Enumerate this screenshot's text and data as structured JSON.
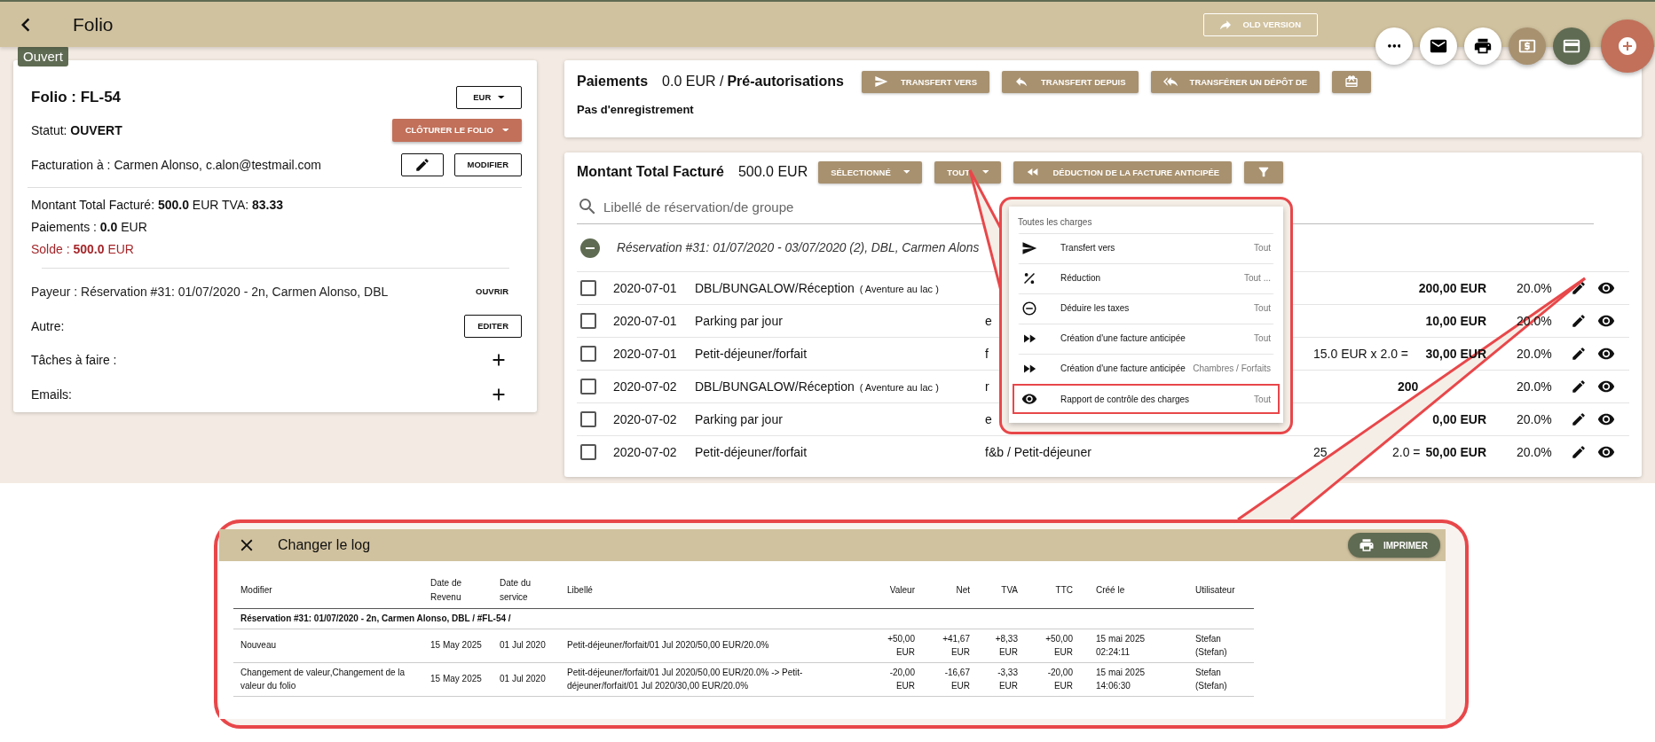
{
  "header": {
    "title": "Folio",
    "old_version_button": "OLD VERSION"
  },
  "folio_card": {
    "badge": "Ouvert",
    "title": "Folio : FL-54",
    "currency": "EUR",
    "status": "Statut: **OUVERT**",
    "close_button": "CLÔTURER LE FOLIO",
    "billing": "Facturation à : Carmen Alonso, c.alon@testmail.com",
    "modify_button": "MODIFIER",
    "total": "Montant Total Facturé:  **500.0**  EUR   TVA: **83.33**",
    "payments": "Paiements :  **0.0**  EUR",
    "balance": "Solde : **500.0** EUR",
    "payer": "Payeur : Réservation #31: 01/07/2020 - 2n, Carmen Alonso, DBL",
    "open_button": "OUVRIR",
    "other_label": "Autre:",
    "edit_button": "EDITER",
    "tasks_label": "Tâches à faire :",
    "emails_label": "Emails:"
  },
  "payments_card": {
    "title": "Paiements",
    "amount": "0.0 EUR /",
    "preauth": "Pré-autorisations",
    "buttons": [
      {
        "kind": "send",
        "label": "TRANSFERT VERS"
      },
      {
        "kind": "reply",
        "label": "TRANSFERT DEPUIS"
      },
      {
        "kind": "reply-all",
        "label": "TRANSFÉRER UN DÉPÔT DE"
      },
      {
        "kind": "gift"
      }
    ],
    "empty": "Pas d'enregistrement"
  },
  "charges_card": {
    "title": "Montant Total Facturé",
    "amount": "500.0 EUR",
    "buttons": [
      {
        "kind": "dropdown",
        "label": "SÉLECTIONNÉ"
      },
      {
        "kind": "dropdown",
        "label": "TOUT"
      },
      {
        "kind": "rewind",
        "label": "DÉDUCTION DE LA FACTURE ANTICIPÉE"
      },
      {
        "kind": "filter"
      }
    ],
    "search_placeholder": "Libellé de réservation/de groupe",
    "group": {
      "title": "Réservation #31: 01/07/2020 - 03/07/2020 (2), DBL, Carmen Alons",
      "expanded": true
    },
    "rows": [
      {
        "checked": false,
        "date": "2020-07-01",
        "name": "DBL/BUNGALOW/Réception",
        "note": "( Aventure au lac )",
        "amount": "200,00 EUR",
        "vat": "20.0%"
      },
      {
        "checked": false,
        "date": "2020-07-01",
        "name": "Parking par jour",
        "category": "e",
        "amount": "10,00 EUR",
        "vat": "20.0%"
      },
      {
        "checked": false,
        "date": "2020-07-01",
        "name": "Petit-déjeuner/forfait",
        "category": "f",
        "price": "15.0 EUR x 2.0 =",
        "amount": "30,00 EUR",
        "vat": "20.0%"
      },
      {
        "checked": false,
        "date": "2020-07-02",
        "name": "DBL/BUNGALOW/Réception",
        "note": "( Aventure au lac )",
        "category": "r",
        "amount": "200",
        "amount_clipped": true,
        "vat": "20.0%"
      },
      {
        "checked": false,
        "date": "2020-07-02",
        "name": "Parking par jour",
        "category": "e",
        "amount": "0,00 EUR",
        "vat": "20.0%"
      },
      {
        "checked": false,
        "date": "2020-07-02",
        "name": "Petit-déjeuner/forfait",
        "category": "f&b / Petit-déjeuner",
        "price": "25",
        "price_tail": "2.0 =",
        "amount": "50,00 EUR",
        "vat": "20.0%"
      }
    ]
  },
  "charges_menu": {
    "header": "Toutes les charges",
    "items": [
      {
        "kind": "send",
        "label": "Transfert vers",
        "scope": "Tout",
        "highlighted": false
      },
      {
        "kind": "percent",
        "label": "Réduction",
        "scope": "Tout ...",
        "highlighted": false
      },
      {
        "kind": "minus-circle",
        "label": "Déduire les taxes",
        "scope": "Tout",
        "highlighted": false
      },
      {
        "kind": "fast-forward",
        "label": "Création d'une facture anticipée",
        "scope": "Tout",
        "highlighted": false
      },
      {
        "kind": "fast-forward",
        "label": "Création d'une facture anticipée",
        "scope": "Chambres / Forfaits",
        "highlighted": false
      },
      {
        "kind": "eye",
        "label": "Rapport de contrôle des charges",
        "scope": "Tout",
        "highlighted": true
      }
    ]
  },
  "change_log": {
    "title": "Changer le log",
    "print_button": "IMPRIMER",
    "columns": [
      "Modifier",
      "Date de Revenu",
      "Date du service",
      "Libellé",
      "Valeur",
      "Net",
      "TVA",
      "TTC",
      "Créé le",
      "Utilisateur"
    ],
    "group": "Réservation #31: 01/07/2020 - 2n, Carmen Alonso, DBL / #FL-54 /",
    "rows": [
      [
        "Nouveau",
        "15 May 2025",
        "01 Jul 2020",
        "Petit-déjeuner/forfait/01 Jul 2020/50,00 EUR/20.0%",
        "+50,00 EUR",
        "+41,67 EUR",
        "+8,33 EUR",
        "+50,00 EUR",
        "15 mai 2025 02:24:11",
        "Stefan (Stefan)"
      ],
      [
        "Changement de valeur,Changement de la valeur du folio",
        "15 May 2025",
        "01 Jul 2020",
        "Petit-déjeuner/forfait/01 Jul 2020/50,00 EUR/20.0% -> Petit-déjeuner/forfait/01 Jul 2020/30,00 EUR/20.0%",
        "-20,00 EUR",
        "-16,67 EUR",
        "-3,33 EUR",
        "-20,00 EUR",
        "15 mai 2025 14:06:30",
        "Stefan (Stefan)"
      ]
    ]
  }
}
